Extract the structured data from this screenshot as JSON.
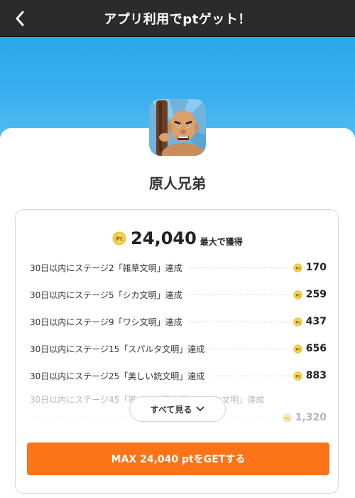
{
  "header": {
    "title": "アプリ利用でptゲット！"
  },
  "app": {
    "name": "原人兄弟"
  },
  "total": {
    "value": "24,040",
    "suffix": "最大で獲得"
  },
  "missions": [
    {
      "label": "30日以内にステージ2「雑草文明」達成",
      "reward": "170"
    },
    {
      "label": "30日以内にステージ5「シカ文明」達成",
      "reward": "259"
    },
    {
      "label": "30日以内にステージ9「ワシ文明」達成",
      "reward": "437"
    },
    {
      "label": "30日以内にステージ15「スパルタ文明」達成",
      "reward": "656"
    },
    {
      "label": "30日以内にステージ25「美しい銃文明」達成",
      "reward": "883"
    },
    {
      "label": "30日以内にステージ45「第二次世界大戦ーーーカ文明」達成",
      "reward": "1,320"
    }
  ],
  "show_all": {
    "label": "すべて見る"
  },
  "cta": {
    "label": "MAX 24,040 ptをGETする"
  },
  "colors": {
    "accent": "#fb7418",
    "hero": "#3ab0ee",
    "coin": "#e7c33a"
  }
}
